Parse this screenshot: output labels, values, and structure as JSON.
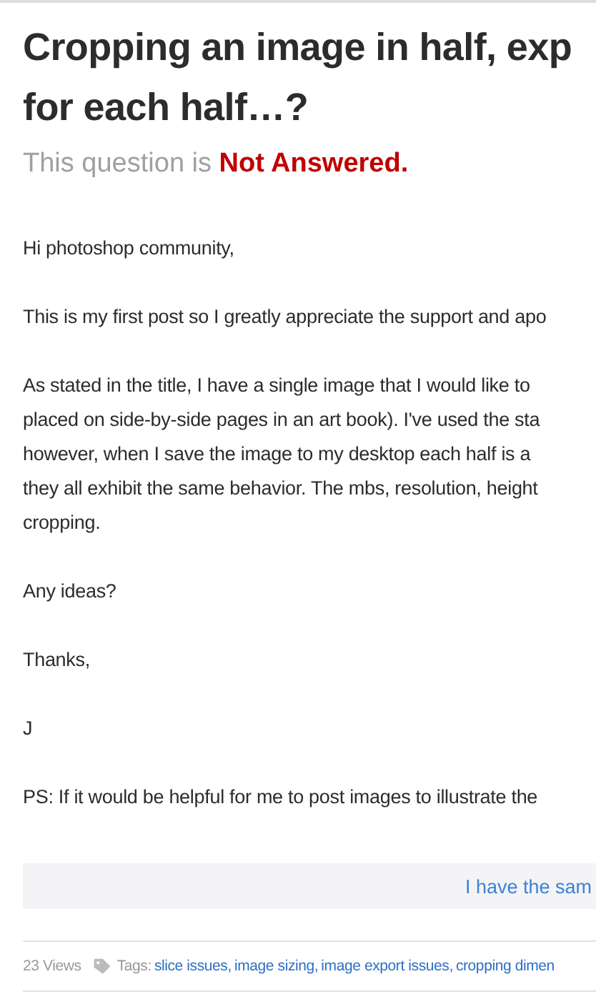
{
  "question": {
    "title_lines": [
      "Cropping an image in half, exp",
      "for each half…?"
    ],
    "status_prefix": "This question is",
    "status": "Not Answered.",
    "body": [
      [
        "Hi photoshop community,"
      ],
      [
        "This is my first post so I greatly appreciate the support and apo"
      ],
      [
        "As stated in the title, I have a single image that I would like to",
        "placed on side-by-side pages in an art book). I've used the sta",
        "however, when I save the image to my desktop each half is a",
        "they all exhibit the same behavior. The mbs, resolution, height",
        "cropping."
      ],
      [
        "Any ideas?"
      ],
      [
        "Thanks,"
      ],
      [
        "J"
      ],
      [
        "PS: If it would be helpful for me to post images to illustrate the"
      ]
    ],
    "same_question_button": "I have the sam",
    "views": "23 Views",
    "tags_label": "Tags:",
    "tags": [
      "slice issues,",
      "image sizing,",
      "image export issues,",
      "cropping dimen"
    ]
  }
}
